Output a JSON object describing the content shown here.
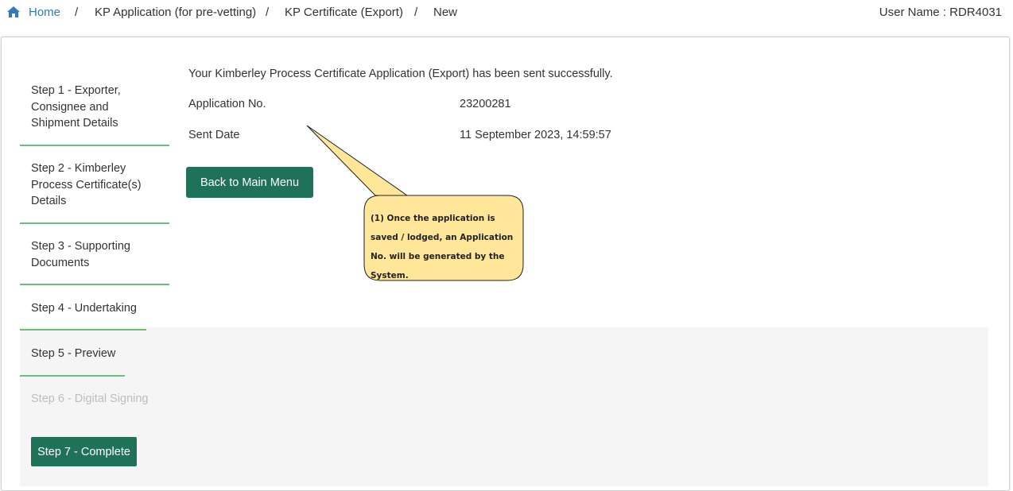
{
  "breadcrumb": {
    "home": "Home",
    "separator": "/",
    "items": [
      "KP Application (for pre-vetting)",
      "KP Certificate (Export)",
      "New"
    ]
  },
  "user": {
    "label": "User Name : RDR4031"
  },
  "steps": [
    "Step 1 - Exporter, Consignee and Shipment Details",
    "Step 2 - Kimberley Process Certificate(s) Details",
    "Step 3 - Supporting Documents",
    "Step 4 - Undertaking",
    "Step 5 - Preview",
    "Step 6 - Digital Signing",
    "Step 7 - Complete"
  ],
  "result": {
    "message": "Your Kimberley Process Certificate Application (Export) has been sent successfully.",
    "application_no_label": "Application No.",
    "application_no": "23200281",
    "sent_date_label": "Sent Date",
    "sent_date": "11 September 2023, 14:59:57",
    "back_button": "Back to Main Menu"
  },
  "callout": {
    "text": "(1) Once the application  is saved / lodged, an Application No. will be generated by the System."
  },
  "colors": {
    "primary_button": "#1f7158",
    "step_underline": "#6cbf7a",
    "link": "#337ab7",
    "callout_fill": "#ffe699"
  },
  "icons": {
    "home": "home-icon"
  }
}
